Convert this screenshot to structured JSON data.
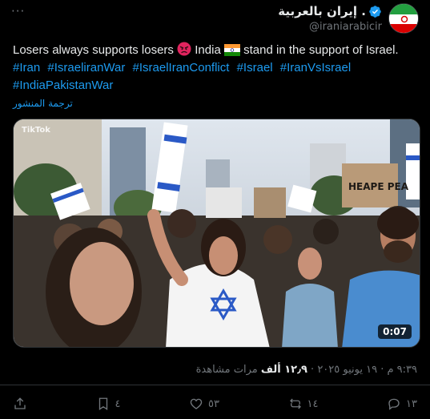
{
  "header": {
    "more_label": "···",
    "display_name": "إيران بالعربية .",
    "handle": "@iraniarabicir"
  },
  "tweet": {
    "text_before": "Losers always supports losers",
    "text_mid": "India",
    "text_after": "stand in the support of Israel.",
    "hashtags": [
      "#Iran",
      "#IsraeliranWar",
      "#IsraelIranConflict",
      "#Israel",
      "#IranVsIsrael",
      "#IndiaPakistanWar"
    ],
    "translate_label": "ترجمة المنشور"
  },
  "media": {
    "duration": "0:07",
    "watermark": "TikTok",
    "sign_text": "HEAPE PEA"
  },
  "meta": {
    "time": "٩:٣٩ م",
    "date": "١٩ يونيو ٢٠٢٥",
    "views_count": "١٢٫٩ ألف",
    "views_label": "مرات مشاهدة"
  },
  "actions": {
    "replies": "١٣",
    "reposts": "١٤",
    "likes": "٥٣",
    "bookmarks": "٤"
  },
  "colors": {
    "background": "#000000",
    "text": "#e7e9ea",
    "muted": "#71767b",
    "link": "#1d9bf0",
    "verified": "#1d9bf0"
  }
}
